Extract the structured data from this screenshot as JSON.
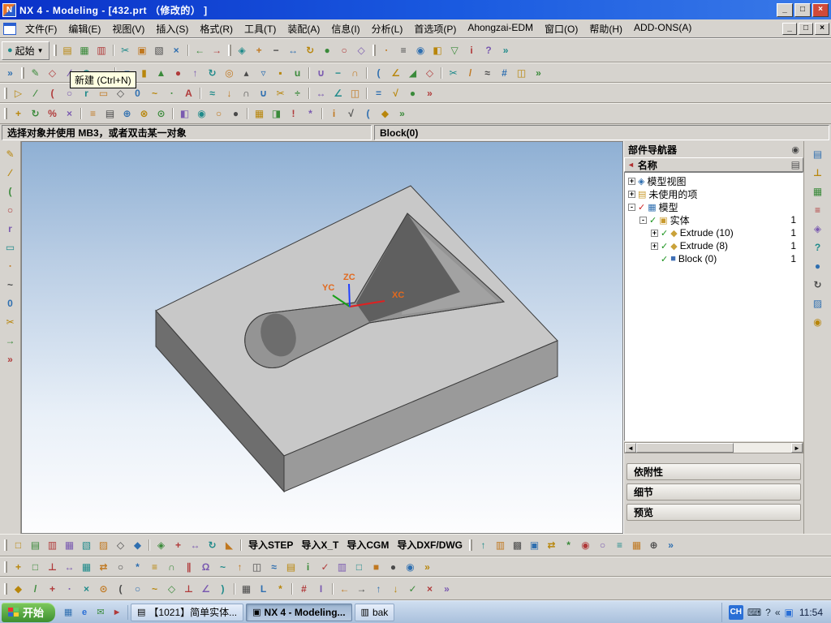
{
  "window": {
    "title": "NX 4 - Modeling - [432.prt （修改的） ]",
    "minimize": "_",
    "maximize": "□",
    "close": "×"
  },
  "menu_bar": {
    "items": [
      "文件(F)",
      "编辑(E)",
      "视图(V)",
      "插入(S)",
      "格式(R)",
      "工具(T)",
      "装配(A)",
      "信息(I)",
      "分析(L)",
      "首选项(P)",
      "Ahongzai-EDM",
      "窗口(O)",
      "帮助(H)",
      "ADD-ONS(A)"
    ]
  },
  "tooltip": {
    "text": "新建 (Ctrl+N)"
  },
  "start_button": {
    "label": "起始"
  },
  "prompt_bar": {
    "message": "选择对象并使用 MB3，或者双击某一对象",
    "status": "Block(0)"
  },
  "viewport": {
    "axes": {
      "x": "XC",
      "y": "YC",
      "z": "ZC"
    }
  },
  "navigator": {
    "title": "部件导航器",
    "column": "名称",
    "sections": [
      "依附性",
      "细节",
      "预览"
    ],
    "tree": [
      {
        "indent": 0,
        "expand": "+",
        "icon": "model-views",
        "glyph": "◈",
        "color": "#2f6fb0",
        "label": "模型视图"
      },
      {
        "indent": 0,
        "expand": "+",
        "icon": "unused-items-folder",
        "glyph": "▤",
        "color": "#c99a2e",
        "label": "未使用的项"
      },
      {
        "indent": 0,
        "expand": "-",
        "check": "red",
        "icon": "model-node",
        "glyph": "▦",
        "color": "#2f6fb0",
        "label": "模型"
      },
      {
        "indent": 1,
        "expand": "-",
        "check": "green",
        "icon": "solid-body",
        "glyph": "▣",
        "color": "#c99a2e",
        "label": "实体",
        "value": "1"
      },
      {
        "indent": 2,
        "expand": "+",
        "check": "green",
        "icon": "extrude-feature",
        "glyph": "◆",
        "color": "#caa23a",
        "label": "Extrude (10)",
        "value": "1"
      },
      {
        "indent": 2,
        "expand": "+",
        "check": "green",
        "icon": "extrude-feature",
        "glyph": "◆",
        "color": "#caa23a",
        "label": "Extrude (8)",
        "value": "1"
      },
      {
        "indent": 2,
        "expand": "",
        "check": "green",
        "icon": "block-feature",
        "glyph": "■",
        "color": "#3f6fb5",
        "label": "Block (0)",
        "value": "1"
      }
    ]
  },
  "toolbars": {
    "row1": [
      [
        "::"
      ],
      [
        "open",
        "▤"
      ],
      [
        "save",
        "▦"
      ],
      [
        "print",
        "▥"
      ],
      [
        "|"
      ],
      [
        "cut",
        "✂"
      ],
      [
        "copy",
        "▣"
      ],
      [
        "paste",
        "▧"
      ],
      [
        "delete",
        "×"
      ],
      [
        "|"
      ],
      [
        "undo",
        "←"
      ],
      [
        "redo",
        "→"
      ],
      [
        "::"
      ],
      [
        "fit-view",
        "◈"
      ],
      [
        "zoom-in",
        "+"
      ],
      [
        "zoom-out",
        "−"
      ],
      [
        "pan",
        "↔"
      ],
      [
        "rotate",
        "↻"
      ],
      [
        "shaded-view",
        "●"
      ],
      [
        "wireframe-view",
        "○"
      ],
      [
        "iso-view",
        "◇"
      ],
      [
        "::"
      ],
      [
        "snap-point",
        "∙"
      ],
      [
        "layer-settings",
        "≡"
      ],
      [
        "show-hide",
        "◉"
      ],
      [
        "edit-object-display",
        "◧"
      ],
      [
        "selection-filter",
        "▽"
      ],
      [
        "information",
        "i"
      ],
      [
        "help",
        "?"
      ],
      [
        "overflow",
        "»"
      ]
    ],
    "row2": [
      [
        "overflow",
        "»"
      ],
      [
        "::"
      ],
      [
        "sketch",
        "✎"
      ],
      [
        "datum-plane",
        "◇"
      ],
      [
        "datum-axis",
        "∕"
      ],
      [
        "datum-csys",
        "⊕"
      ],
      [
        "point",
        "∙"
      ],
      [
        "|"
      ],
      [
        "block",
        "■"
      ],
      [
        "cylinder",
        "▮"
      ],
      [
        "cone",
        "▲"
      ],
      [
        "sphere",
        "●"
      ],
      [
        "extrude",
        "↑"
      ],
      [
        "revolve",
        "↻"
      ],
      [
        "hole",
        "◎"
      ],
      [
        "boss",
        "▴"
      ],
      [
        "pocket",
        "▿"
      ],
      [
        "pad",
        "▪"
      ],
      [
        "groove",
        "u"
      ],
      [
        "|"
      ],
      [
        "unite",
        "∪"
      ],
      [
        "subtract",
        "−"
      ],
      [
        "intersect",
        "∩"
      ],
      [
        "|"
      ],
      [
        "edge-blend",
        "("
      ],
      [
        "chamfer",
        "∠"
      ],
      [
        "draft",
        "◢"
      ],
      [
        "shell",
        "◇"
      ],
      [
        "|"
      ],
      [
        "trim-body",
        "✂"
      ],
      [
        "split-body",
        "/"
      ],
      [
        "sew",
        "≈"
      ],
      [
        "instance-array",
        "#"
      ],
      [
        "mirror-body",
        "◫"
      ],
      [
        "overflow",
        "»"
      ]
    ],
    "row3": [
      [
        "::"
      ],
      [
        "profile",
        "▷"
      ],
      [
        "line",
        "∕"
      ],
      [
        "arc",
        "("
      ],
      [
        "circle",
        "○"
      ],
      [
        "fillet",
        "r"
      ],
      [
        "rectangle",
        "▭"
      ],
      [
        "polygon",
        "◇"
      ],
      [
        "ellipse",
        "0"
      ],
      [
        "spline",
        "~"
      ],
      [
        "point-curve",
        "∙"
      ],
      [
        "text-curve",
        "A"
      ],
      [
        "|"
      ],
      [
        "offset-curve",
        "≈"
      ],
      [
        "project-curve",
        "↓"
      ],
      [
        "intersection-curve",
        "∩"
      ],
      [
        "join-curve",
        "∪"
      ],
      [
        "trim-curve",
        "✂"
      ],
      [
        "divide-curve",
        "÷"
      ],
      [
        "|"
      ],
      [
        "measure-distance",
        "↔"
      ],
      [
        "measure-angle",
        "∠"
      ],
      [
        "section-analysis",
        "◫"
      ],
      [
        "|"
      ],
      [
        "expressions",
        "="
      ],
      [
        "simple-analysis",
        "√"
      ],
      [
        "macro",
        "●"
      ],
      [
        "overflow",
        "»"
      ]
    ],
    "row4": [
      [
        "::"
      ],
      [
        "move-object",
        "+"
      ],
      [
        "rotate-object",
        "↻"
      ],
      [
        "scale-object",
        "%"
      ],
      [
        "delete-object",
        "×"
      ],
      [
        "|"
      ],
      [
        "layer-settings-2",
        "≡"
      ],
      [
        "layer-visible-in-view",
        "▤"
      ],
      [
        "wcs-dynamics",
        "⊕"
      ],
      [
        "wcs-orient",
        "⊗"
      ],
      [
        "wcs-set-origin",
        "⊙"
      ],
      [
        "|"
      ],
      [
        "object-display",
        "◧"
      ],
      [
        "show-and-hide",
        "◉"
      ],
      [
        "blank-object",
        "○"
      ],
      [
        "unblank-object",
        "●"
      ],
      [
        "|"
      ],
      [
        "named-views",
        "▦"
      ],
      [
        "clip-section",
        "◨"
      ],
      [
        "update-model",
        "!"
      ],
      [
        "regenerate",
        "*"
      ],
      [
        "|"
      ],
      [
        "object-information",
        "i"
      ],
      [
        "analysis-check",
        "√"
      ],
      [
        "curve-analysis",
        "("
      ],
      [
        "face-analysis",
        "◆"
      ],
      [
        "overflow",
        "»"
      ]
    ],
    "bottom1": [
      [
        "::"
      ],
      [
        "front-view",
        "□"
      ],
      [
        "top-view",
        "▤"
      ],
      [
        "right-view",
        "▥"
      ],
      [
        "left-view",
        "▦"
      ],
      [
        "bottom-view",
        "▧"
      ],
      [
        "back-view",
        "▨"
      ],
      [
        "isometric-view",
        "◇"
      ],
      [
        "trimetric-view",
        "◆"
      ],
      [
        "|"
      ],
      [
        "fit-all",
        "◈"
      ],
      [
        "zoom-view",
        "+"
      ],
      [
        "pan-view",
        "↔"
      ],
      [
        "rotate-view",
        "↻"
      ],
      [
        "perspective-view",
        "◣"
      ],
      [
        "|"
      ],
      [
        "t:导入STEP",
        "import-step-button"
      ],
      [
        "t:导入X_T",
        "import-xt-button"
      ],
      [
        "t:导入CGM",
        "import-cgm-button"
      ],
      [
        "t:导入DXF/DWG",
        "import-dxfdwg-button"
      ],
      [
        "::"
      ],
      [
        "export-part",
        "↑"
      ],
      [
        "print-view",
        "▥"
      ],
      [
        "plot",
        "▩"
      ],
      [
        "cgm-export",
        "▣"
      ],
      [
        "sync-views",
        "⇄"
      ],
      [
        "redraw",
        "*"
      ],
      [
        "highlight",
        "◉"
      ],
      [
        "unhighlight",
        "○"
      ],
      [
        "view-preferences",
        "≡"
      ],
      [
        "grid-toggle",
        "▦"
      ],
      [
        "triad-toggle",
        "⊕"
      ],
      [
        "overflow",
        "»"
      ]
    ],
    "bottom2": [
      [
        "::"
      ],
      [
        "add-component",
        "+"
      ],
      [
        "create-component",
        "□"
      ],
      [
        "mate-constraint",
        "⊥"
      ],
      [
        "move-component",
        "↔"
      ],
      [
        "pattern-component",
        "▦"
      ],
      [
        "replace-component",
        "⇄"
      ],
      [
        "suppress-component",
        "○"
      ],
      [
        "explode-assembly",
        "*"
      ],
      [
        "sequence",
        "≡"
      ],
      [
        "interference-check",
        "∩"
      ],
      [
        "clearance-analysis",
        "∥"
      ],
      [
        "assembly-weight",
        "Ω"
      ],
      [
        "wave-link",
        "~"
      ],
      [
        "promote-body",
        "↑"
      ],
      [
        "mirror-assembly",
        "◫"
      ],
      [
        "deformable-part",
        "≈"
      ],
      [
        "arrangements",
        "▤"
      ],
      [
        "assembly-info",
        "i"
      ],
      [
        "check-mate",
        "✓"
      ],
      [
        "report",
        "▥"
      ],
      [
        "open-component",
        "□"
      ],
      [
        "close-component",
        "■"
      ],
      [
        "work-part",
        "●"
      ],
      [
        "displayed-part",
        "◉"
      ],
      [
        "overflow",
        "»"
      ]
    ],
    "bottom3": [
      [
        "::"
      ],
      [
        "snap-toggle",
        "◆"
      ],
      [
        "end-point",
        "/"
      ],
      [
        "mid-point",
        "+"
      ],
      [
        "control-point",
        "∙"
      ],
      [
        "intersection-point",
        "×"
      ],
      [
        "arc-center",
        "⊙"
      ],
      [
        "quadrant-point",
        "("
      ],
      [
        "existing-point",
        "○"
      ],
      [
        "point-on-curve",
        "~"
      ],
      [
        "point-on-face",
        "◇"
      ],
      [
        "constraint-point",
        "⊥"
      ],
      [
        "angle-snap",
        "∠"
      ],
      [
        "tangent-point",
        ")"
      ],
      [
        "|"
      ],
      [
        "grid-snap",
        "▦"
      ],
      [
        "ortho-mode",
        "L"
      ],
      [
        "polar-mode",
        "*"
      ],
      [
        "|"
      ],
      [
        "coordinate-entry",
        "#"
      ],
      [
        "dynamic-input",
        "I"
      ],
      [
        "|"
      ],
      [
        "back-arrow",
        "←"
      ],
      [
        "forward-arrow",
        "→"
      ],
      [
        "up-arrow",
        "↑"
      ],
      [
        "down-arrow",
        "↓"
      ],
      [
        "confirm",
        "✓"
      ],
      [
        "cancel",
        "×"
      ],
      [
        "overflow",
        "»"
      ]
    ],
    "left": [
      [
        "sketch-tool",
        "✎",
        "#b8860b"
      ],
      [
        "line-tool",
        "∕"
      ],
      [
        "arc-tool",
        "("
      ],
      [
        "circle-tool",
        "○"
      ],
      [
        "fillet-tool",
        "r"
      ],
      [
        "rectangle-tool",
        "▭"
      ],
      [
        "point-tool",
        "∙"
      ],
      [
        "spline-tool",
        "~"
      ],
      [
        "ellipse-tool",
        "0"
      ],
      [
        "quick-trim",
        "✂"
      ],
      [
        "extend-tool",
        "→"
      ],
      [
        "more-tools",
        "»"
      ]
    ],
    "right": [
      [
        "assembly-navigator",
        "▤"
      ],
      [
        "constraint-navigator",
        "⊥"
      ],
      [
        "part-navigator-tab",
        "▦"
      ],
      [
        "operation-navigator",
        "≡"
      ],
      [
        "reuse-library",
        "◈"
      ],
      [
        "help-panel",
        "?"
      ],
      [
        "internet-browser",
        "●",
        "#2f6fb0"
      ],
      [
        "history-palette",
        "↻"
      ],
      [
        "palettes",
        "▨"
      ],
      [
        "visualization",
        "◉"
      ]
    ]
  },
  "taskbar": {
    "start": "开始",
    "quick_launch": [
      [
        "show-desktop",
        "▦"
      ],
      [
        "internet-explorer",
        "e",
        "#2a6fd6"
      ],
      [
        "outlook-express",
        "✉"
      ],
      [
        "media-player",
        "►",
        "#b03a3a"
      ]
    ],
    "tasks": [
      {
        "name": "notepad-task",
        "icon": "▤",
        "icon_name": "notepad-icon",
        "label": "【1021】简单实体...",
        "active": false
      },
      {
        "name": "nx-task",
        "icon": "▣",
        "icon_name": "nx-icon",
        "label": "NX 4 - Modeling...",
        "active": true
      },
      {
        "name": "folder-task",
        "icon": "▥",
        "icon_name": "folder-icon",
        "label": "bak",
        "active": false
      }
    ],
    "tray": {
      "ime": "CH",
      "time": "11:54",
      "collapse": "«"
    }
  },
  "icon_palette": [
    "#2f6fb0",
    "#b8860b",
    "#3a8a3a",
    "#b03a3a",
    "#7a5ab0",
    "#1f8a8a",
    "#c07820",
    "#4a4a4a"
  ],
  "colors": {
    "check_red": "#cc2020",
    "check_green": "#18921b",
    "axis_x": "#e02020",
    "axis_y": "#18a018",
    "axis_z": "#2040ff",
    "axis_label": "#e2691e",
    "titlebar_blue": "#0a31c8",
    "start_green": "#3d8f2f",
    "ime_badge_blue": "#2a6fd6"
  }
}
